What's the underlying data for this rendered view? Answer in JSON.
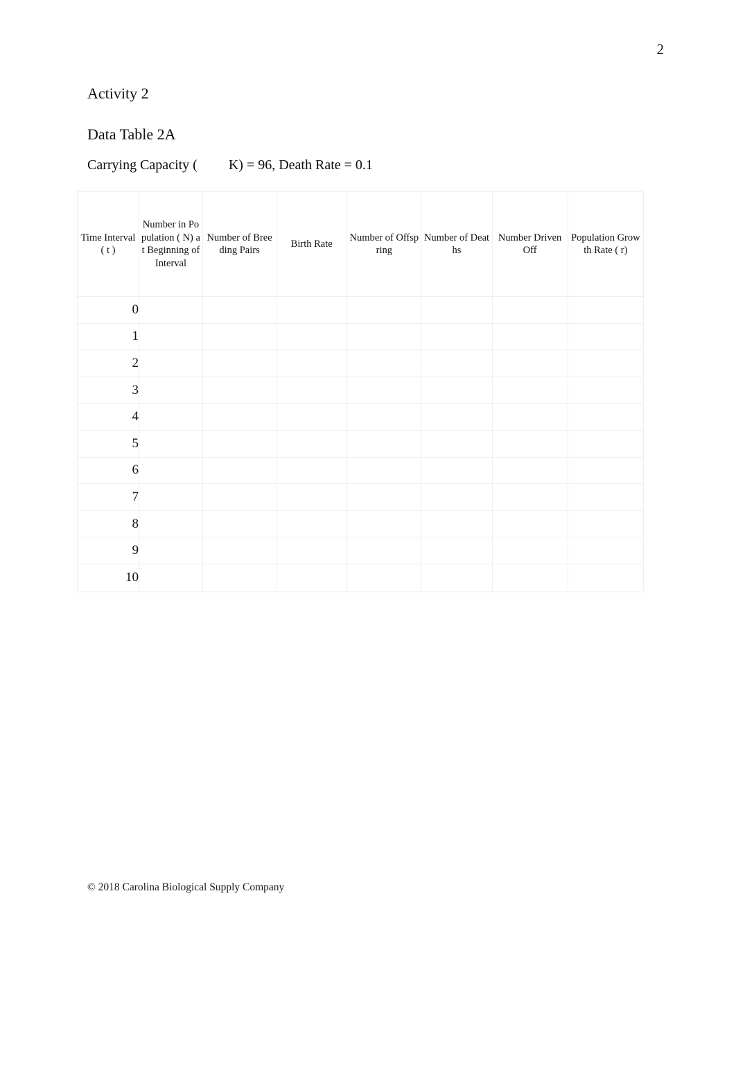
{
  "page": {
    "page_number": "2"
  },
  "headings": {
    "activity": "Activity 2",
    "data_table": "Data Table 2A",
    "parameters": "Carrying Capacity (         K) = 96, Death Rate = 0.1"
  },
  "table": {
    "columns": [
      "Time Interval ( t )",
      "Number in Population ( N) at Beginning of Interval",
      "Number of Breeding Pairs",
      "Birth Rate",
      "Number of Offspring",
      "Number of Deaths",
      "Number Driven Off",
      "Population Growth Rate (    r)"
    ],
    "rows": [
      {
        "time_interval": "0",
        "population": "",
        "breeding_pairs": "",
        "birth_rate": "",
        "offspring": "",
        "deaths": "",
        "driven_off": "",
        "growth_rate": ""
      },
      {
        "time_interval": "1",
        "population": "",
        "breeding_pairs": "",
        "birth_rate": "",
        "offspring": "",
        "deaths": "",
        "driven_off": "",
        "growth_rate": ""
      },
      {
        "time_interval": "2",
        "population": "",
        "breeding_pairs": "",
        "birth_rate": "",
        "offspring": "",
        "deaths": "",
        "driven_off": "",
        "growth_rate": ""
      },
      {
        "time_interval": "3",
        "population": "",
        "breeding_pairs": "",
        "birth_rate": "",
        "offspring": "",
        "deaths": "",
        "driven_off": "",
        "growth_rate": ""
      },
      {
        "time_interval": "4",
        "population": "",
        "breeding_pairs": "",
        "birth_rate": "",
        "offspring": "",
        "deaths": "",
        "driven_off": "",
        "growth_rate": ""
      },
      {
        "time_interval": "5",
        "population": "",
        "breeding_pairs": "",
        "birth_rate": "",
        "offspring": "",
        "deaths": "",
        "driven_off": "",
        "growth_rate": ""
      },
      {
        "time_interval": "6",
        "population": "",
        "breeding_pairs": "",
        "birth_rate": "",
        "offspring": "",
        "deaths": "",
        "driven_off": "",
        "growth_rate": ""
      },
      {
        "time_interval": "7",
        "population": "",
        "breeding_pairs": "",
        "birth_rate": "",
        "offspring": "",
        "deaths": "",
        "driven_off": "",
        "growth_rate": ""
      },
      {
        "time_interval": "8",
        "population": "",
        "breeding_pairs": "",
        "birth_rate": "",
        "offspring": "",
        "deaths": "",
        "driven_off": "",
        "growth_rate": ""
      },
      {
        "time_interval": "9",
        "population": "",
        "breeding_pairs": "",
        "birth_rate": "",
        "offspring": "",
        "deaths": "",
        "driven_off": "",
        "growth_rate": ""
      },
      {
        "time_interval": "10",
        "population": "",
        "breeding_pairs": "",
        "birth_rate": "",
        "offspring": "",
        "deaths": "",
        "driven_off": "",
        "growth_rate": ""
      }
    ]
  },
  "footer": {
    "copyright": "© 2018 Carolina Biological Supply Company"
  }
}
